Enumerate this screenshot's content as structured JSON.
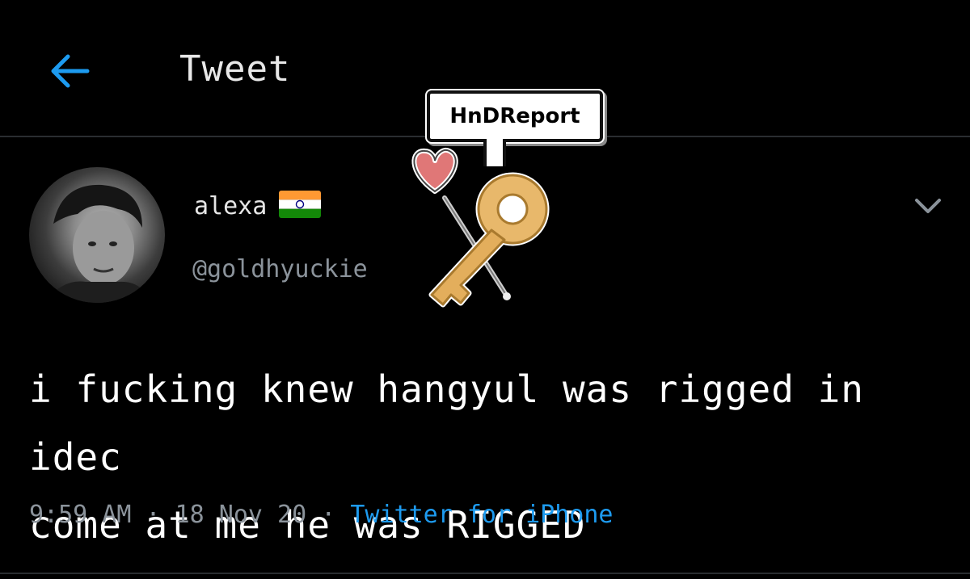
{
  "header": {
    "title": "Tweet",
    "back_icon": "arrow-left-icon"
  },
  "watermark": {
    "label": "HnDReport"
  },
  "tweet": {
    "author_name": "alexa",
    "author_flag": "india-flag-icon",
    "handle": "@goldhyuckie",
    "text_line1": "i fucking knew hangyul was rigged in idec",
    "text_line2": "come at me he was RIGGED",
    "time": "9:59 AM",
    "separator": " · ",
    "date": "18 Nov 20",
    "source": "Twitter for iPhone",
    "more_icon": "chevron-down-icon"
  },
  "colors": {
    "background": "#000000",
    "accent": "#1d9bf0",
    "muted": "#8b939b",
    "divider": "#2a2d31"
  }
}
